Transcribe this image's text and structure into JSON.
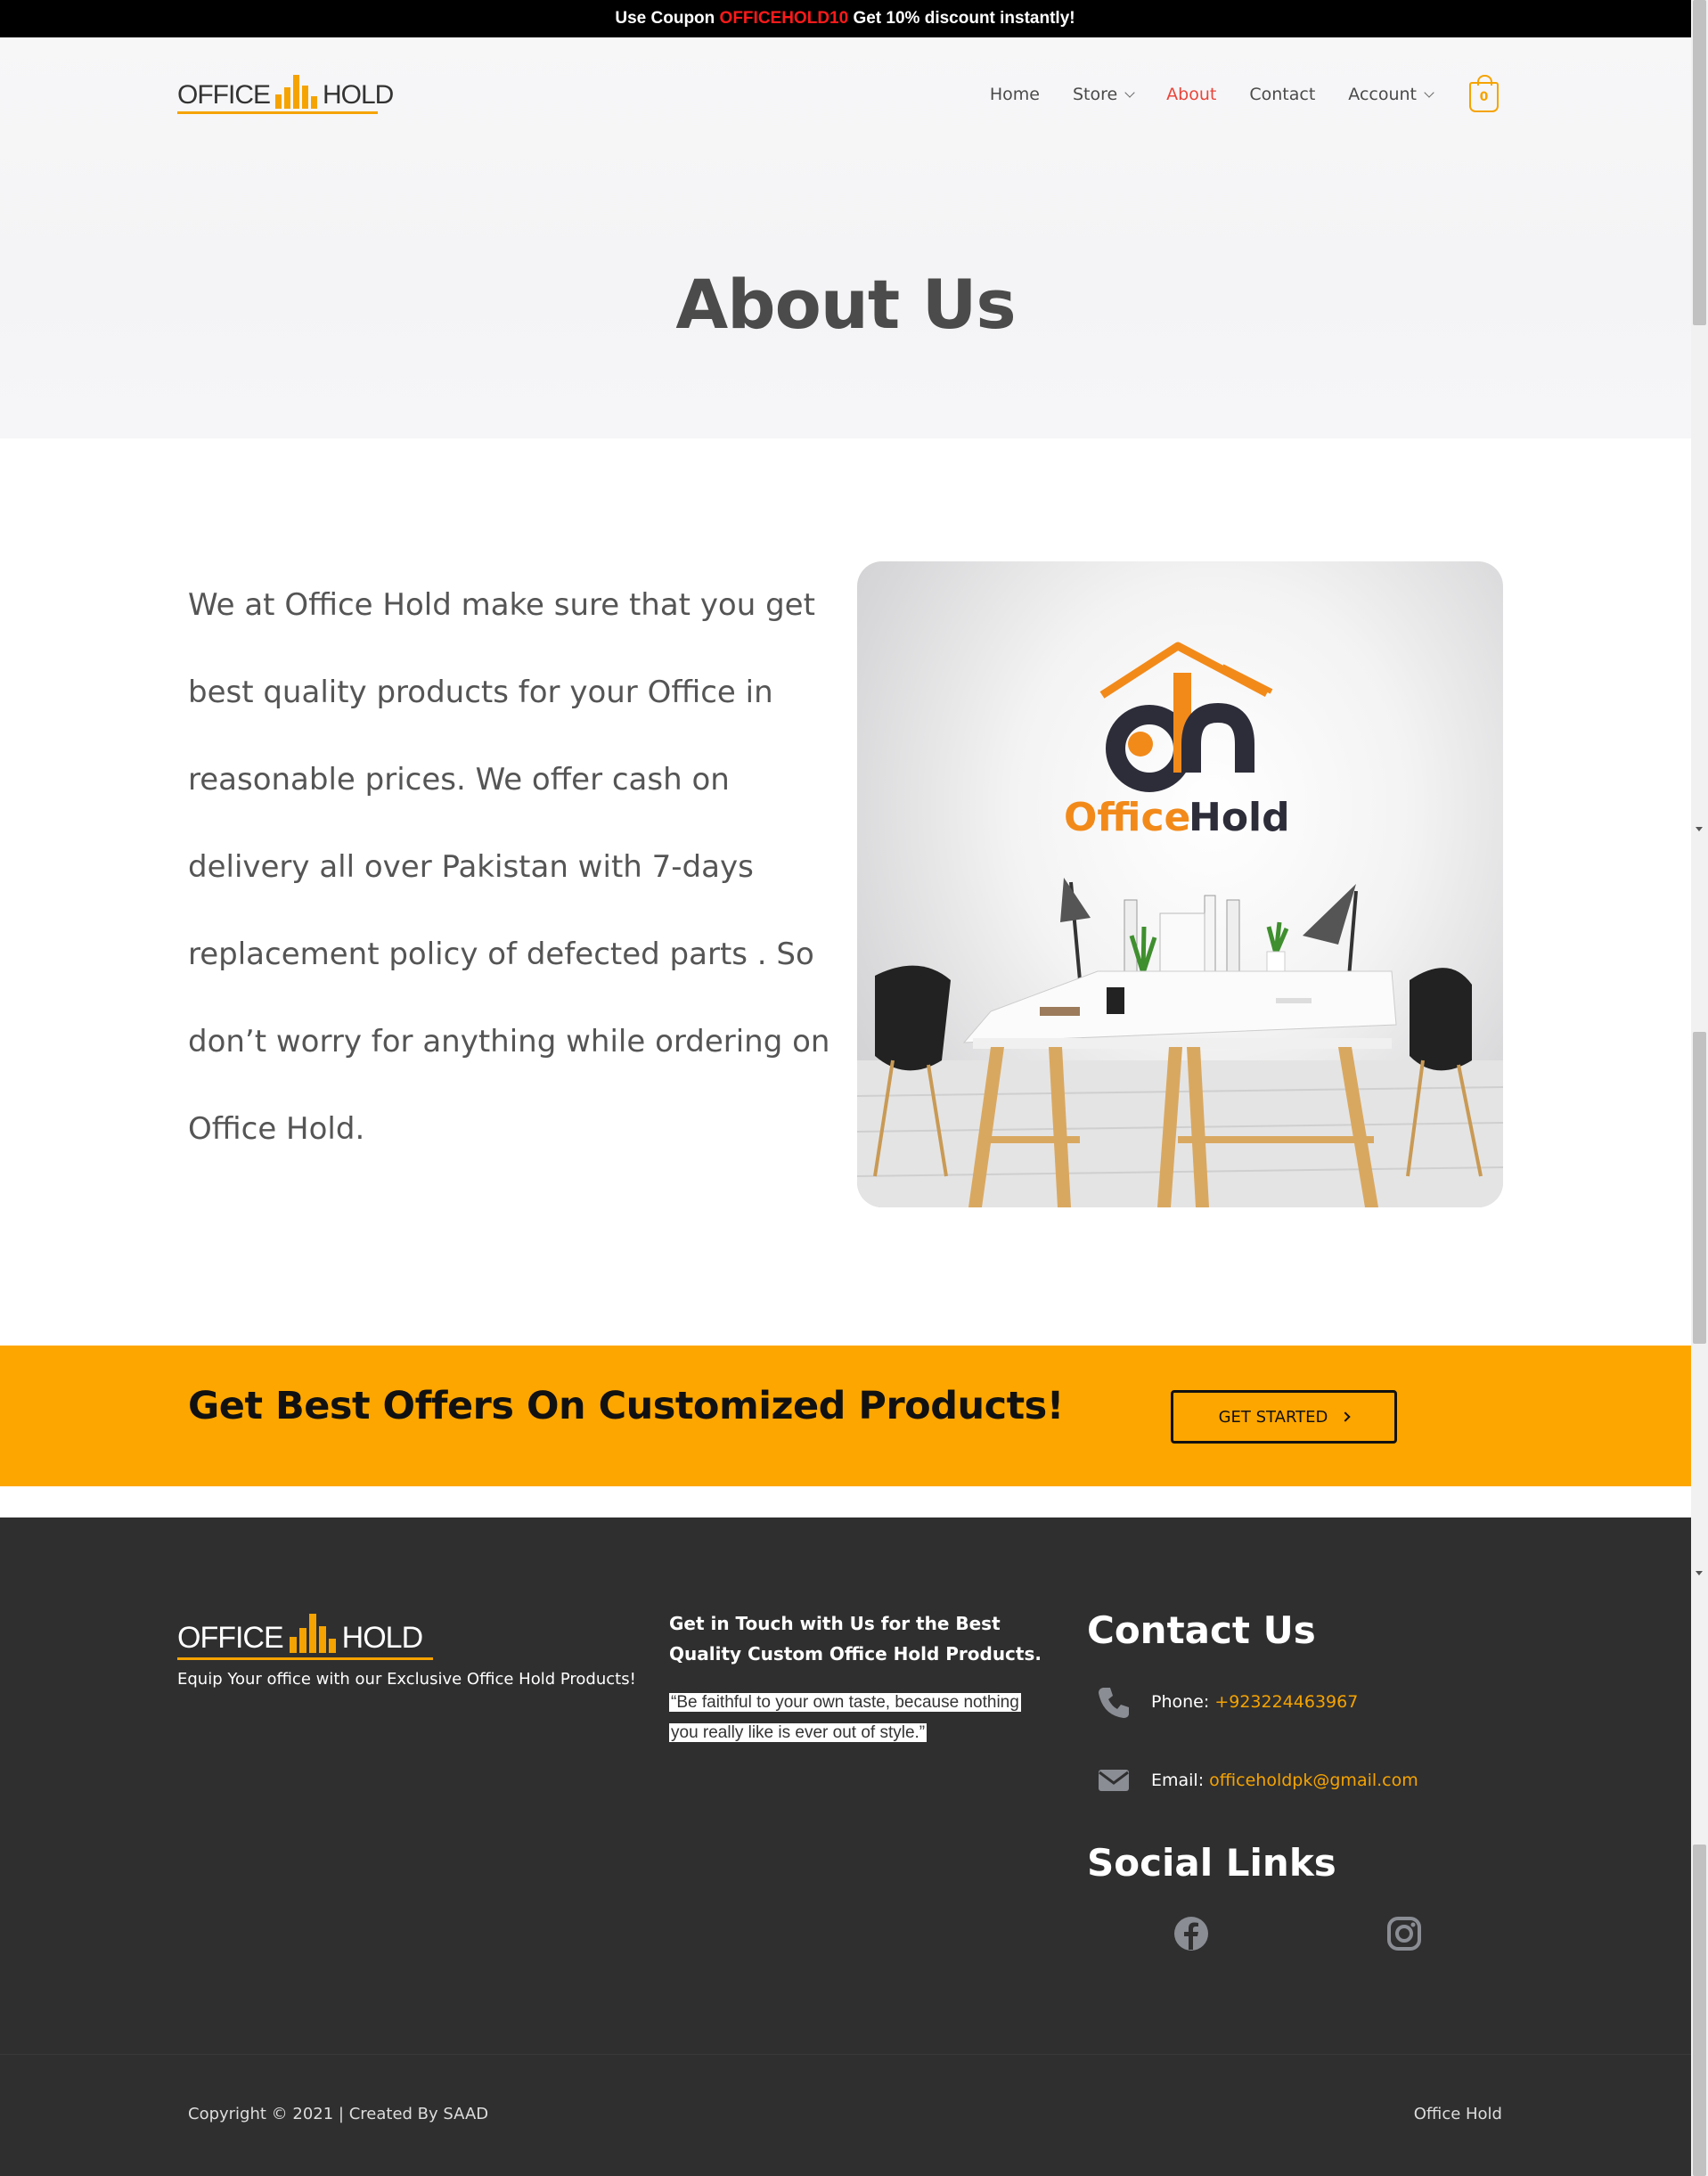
{
  "announcement": {
    "prefix": "Use Coupon",
    "code": "OFFICEHOLD10",
    "suffix": "Get 10% discount instantly!"
  },
  "header": {
    "logo_left": "OFFICE",
    "logo_right": "HOLD",
    "nav": [
      {
        "label": "Home"
      },
      {
        "label": "Store"
      },
      {
        "label": "About"
      },
      {
        "label": "Contact"
      },
      {
        "label": "Account"
      }
    ],
    "cart_count": "0",
    "accent_color": "#f5a300",
    "active_color": "#e9453a"
  },
  "hero": {
    "title": "About Us"
  },
  "about": {
    "text": "We at Office Hold make sure that you get best quality products for your Office in reasonable prices. We offer cash on delivery all over Pakistan with 7-days replacement policy of defected parts . So don’t worry for anything while ordering on Office Hold.",
    "image_brand_1": "Office",
    "image_brand_2": "Hold"
  },
  "cta": {
    "title": "Get Best Offers On Customized Products!",
    "button_label": "GET STARTED",
    "background_color": "#fea600"
  },
  "footer": {
    "logo_left": "OFFICE",
    "logo_right": "HOLD",
    "tagline": "Equip Your office with our Exclusive Office Hold Products!",
    "mid_heading": "Get in Touch with Us for the Best Quality Custom Office Hold Products.",
    "quote": "“Be faithful to your own taste, because nothing you really like is ever out of style.”",
    "contact_heading": "Contact Us",
    "phone_label": "Phone:",
    "phone_value": "+923224463967",
    "email_label": "Email:",
    "email_value": "officeholdpk@gmail.com",
    "social_heading": "Social Links",
    "social": [
      {
        "icon": "facebook-icon"
      },
      {
        "icon": "instagram-icon"
      }
    ],
    "copyright": "Copyright © 2021 | Created By SAAD",
    "right_text": "Office Hold",
    "background_color": "#2f2f30"
  }
}
